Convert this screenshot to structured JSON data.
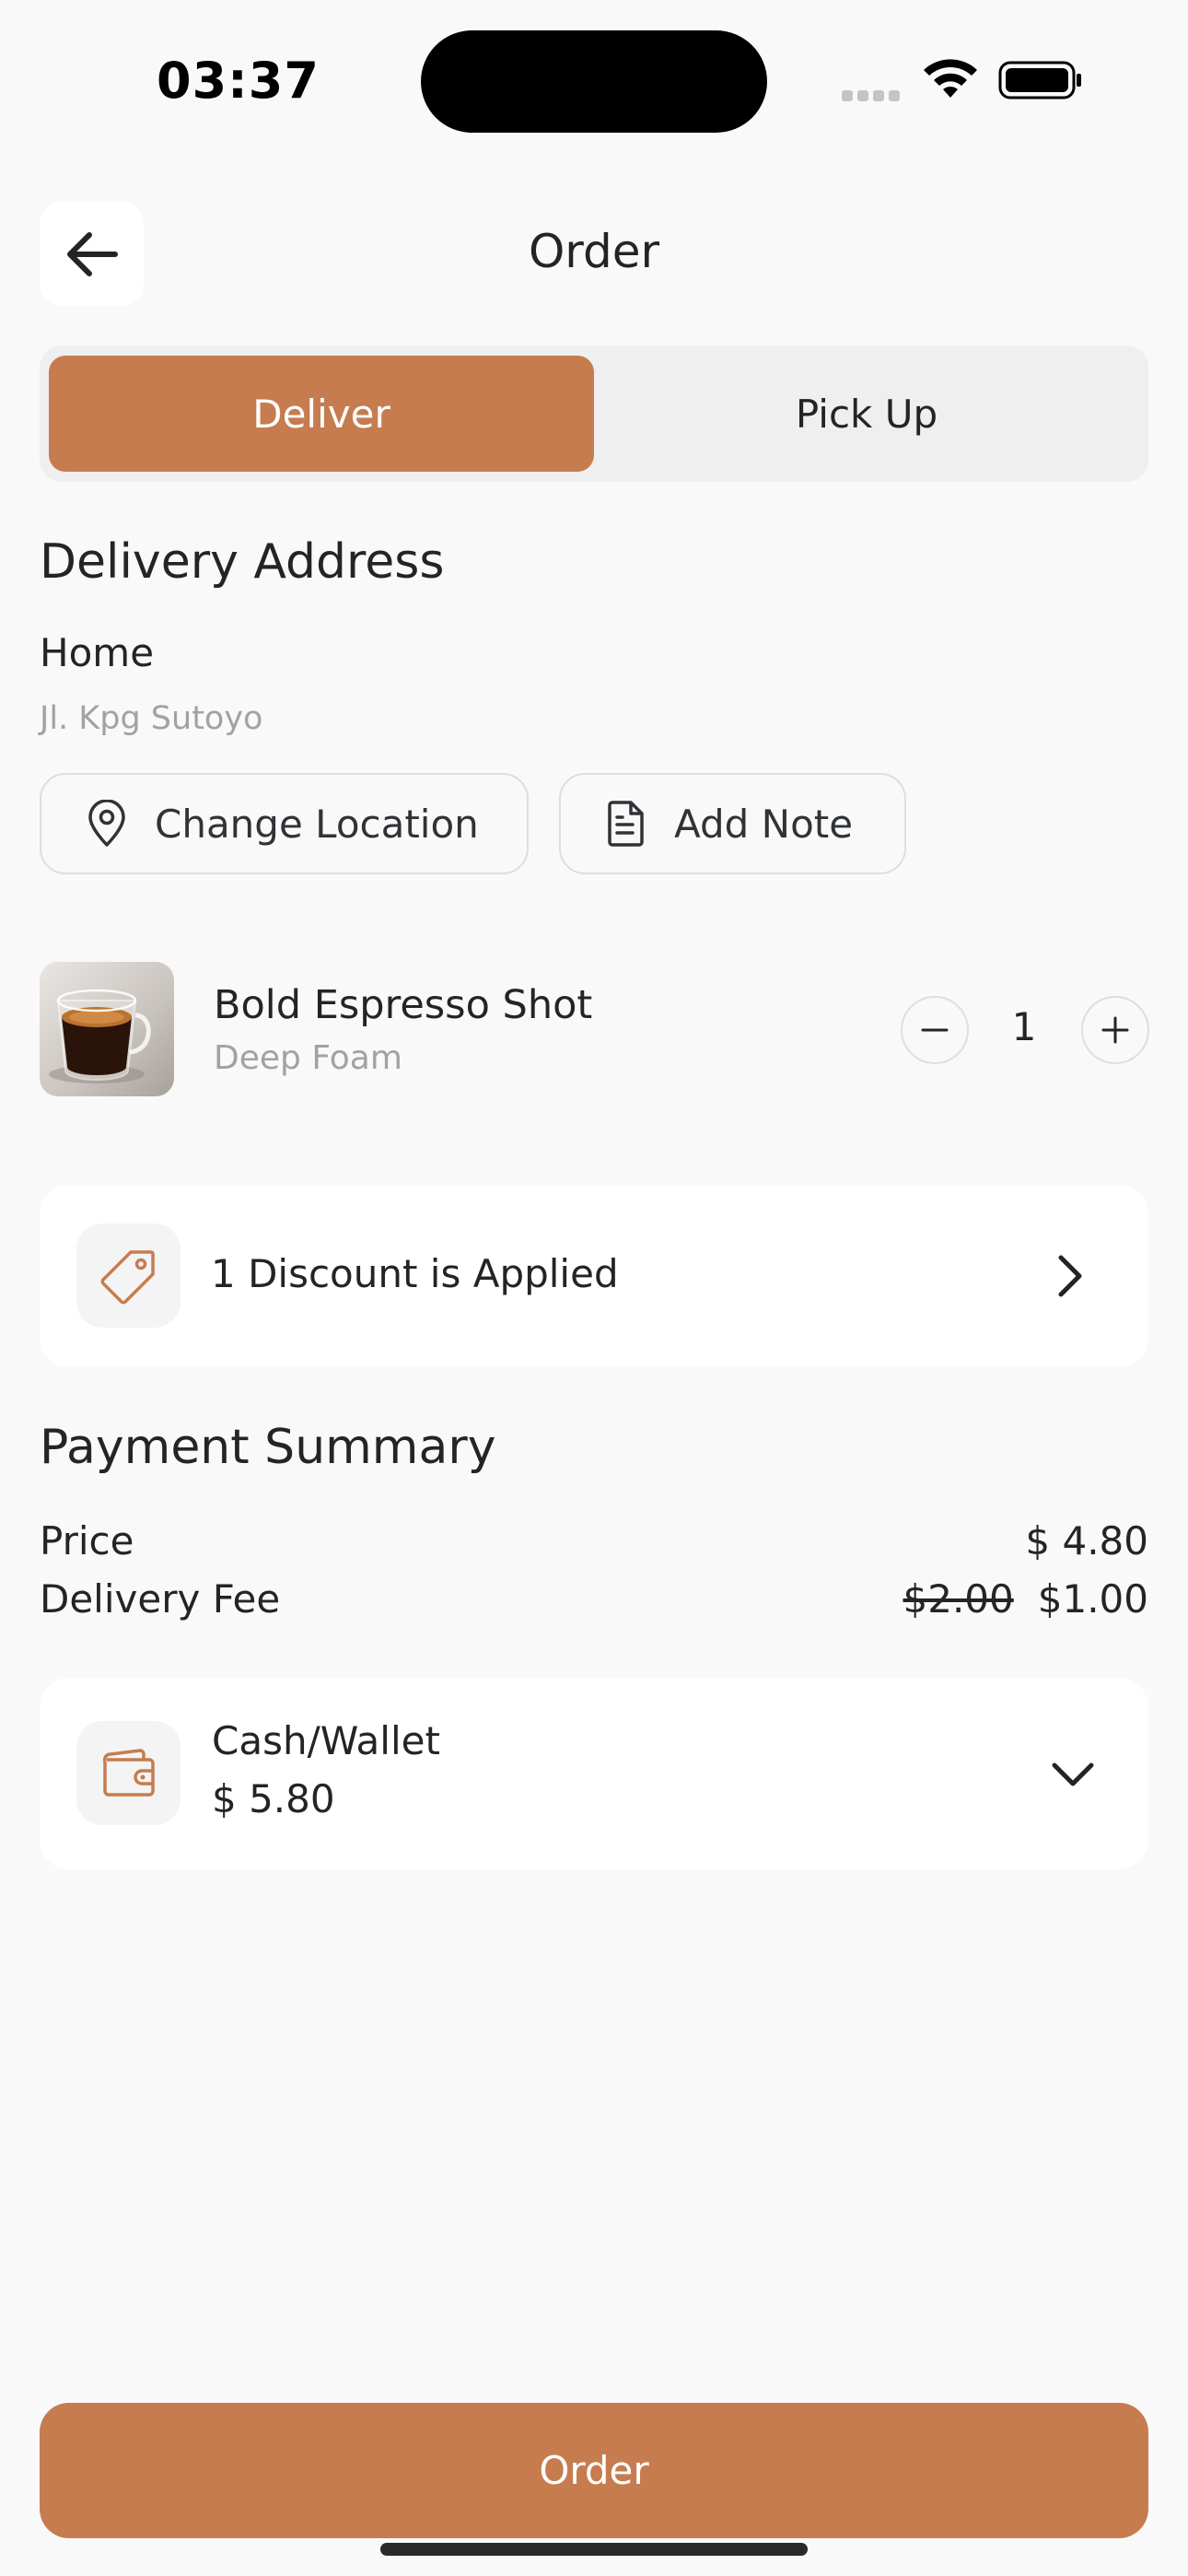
{
  "status_bar": {
    "time": "03:37"
  },
  "header": {
    "title": "Order"
  },
  "tabs": [
    {
      "label": "Deliver",
      "active": true
    },
    {
      "label": "Pick Up",
      "active": false
    }
  ],
  "delivery": {
    "section_title": "Delivery Address",
    "address_label": "Home",
    "address_detail": "Jl. Kpg Sutoyo",
    "change_location_label": "Change Location",
    "add_note_label": "Add Note"
  },
  "item": {
    "name": "Bold Espresso Shot",
    "variant": "Deep Foam",
    "quantity": "1"
  },
  "discount": {
    "label": "1 Discount is Applied"
  },
  "payment_summary": {
    "title": "Payment Summary",
    "price_label": "Price",
    "price_value": "$ 4.80",
    "delivery_fee_label": "Delivery Fee",
    "delivery_fee_original": "$2.00",
    "delivery_fee_value": "$1.00"
  },
  "payment_method": {
    "name": "Cash/Wallet",
    "amount": "$ 5.80"
  },
  "footer": {
    "order_button_label": "Order"
  },
  "colors": {
    "accent": "#C67C4E",
    "background": "#F9F9F9",
    "text": "#242424",
    "muted": "#A2A2A2"
  }
}
